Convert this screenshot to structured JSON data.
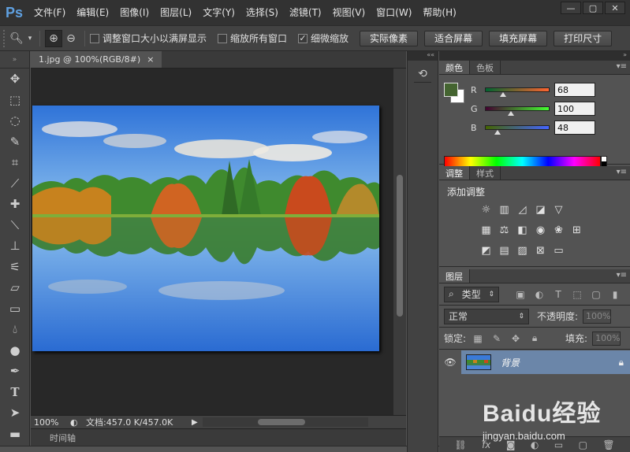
{
  "app": {
    "logo": "Ps",
    "window_controls": [
      "—",
      "▢",
      "✕"
    ]
  },
  "menu": [
    "文件(F)",
    "编辑(E)",
    "图像(I)",
    "图层(L)",
    "文字(Y)",
    "选择(S)",
    "滤镜(T)",
    "视图(V)",
    "窗口(W)",
    "帮助(H)"
  ],
  "options": {
    "resize_windows_label": "调整窗口大小以满屏显示",
    "resize_windows_checked": false,
    "zoom_all_label": "缩放所有窗口",
    "zoom_all_checked": false,
    "scrubby_zoom_label": "细微缩放",
    "scrubby_zoom_checked": true,
    "actual_pixels": "实际像素",
    "fit_screen": "适合屏幕",
    "fill_screen": "填充屏幕",
    "print_size": "打印尺寸"
  },
  "document": {
    "tab_title": "1.jpg @ 100%(RGB/8#)",
    "tab_close": "×",
    "zoom": "100%",
    "doc_info": "文档:457.0 K/457.0K"
  },
  "timeline": {
    "label": "时间轴"
  },
  "color_panel": {
    "tabs": [
      "颜色",
      "色板"
    ],
    "foreground": "#446430",
    "background": "#ffffff",
    "channels": [
      {
        "label": "R",
        "value": "68",
        "fraction": 0.267
      },
      {
        "label": "G",
        "value": "100",
        "fraction": 0.392
      },
      {
        "label": "B",
        "value": "48",
        "fraction": 0.188
      }
    ]
  },
  "adjustments_panel": {
    "tabs": [
      "调整",
      "样式"
    ],
    "title": "添加调整"
  },
  "layers_panel": {
    "tab": "图层",
    "filter_kind": "类型",
    "blend_mode": "正常",
    "opacity_label": "不透明度:",
    "opacity_value": "100%",
    "lock_label": "锁定:",
    "fill_label": "填充:",
    "fill_value": "100%",
    "layers": [
      {
        "name": "背景",
        "visible": true,
        "locked": true
      }
    ]
  },
  "watermark": {
    "logo": "Baidu经验",
    "url": "jingyan.baidu.com"
  }
}
